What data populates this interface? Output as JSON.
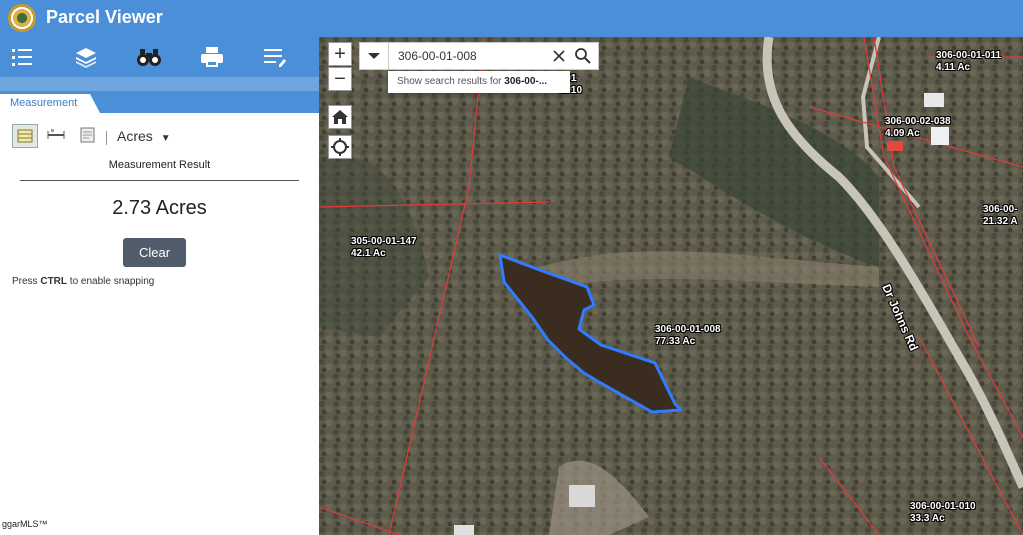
{
  "header": {
    "title": "Parcel Viewer"
  },
  "toolbar": {
    "tools": [
      "list-icon",
      "layers-icon",
      "binoculars-icon",
      "print-icon",
      "edit-list-icon"
    ]
  },
  "panel": {
    "tab_label": "Measurement",
    "unit": "Acres",
    "result_label": "Measurement Result",
    "result_value": "2.73 Acres",
    "clear_label": "Clear",
    "hint_prefix": "Press ",
    "hint_key": "CTRL",
    "hint_suffix": " to enable snapping"
  },
  "watermark": "ggarMLS™",
  "map": {
    "zoom_in": "+",
    "zoom_out": "−",
    "search_value": "306-00-01-008",
    "suggest_prefix": "Show search results for ",
    "suggest_bold": "306-00-...",
    "road_label": "Dr Johns Rd",
    "parcels": [
      {
        "id": "306-00-01-011",
        "area": "4.11 Ac"
      },
      {
        "id": "306-00-02-038",
        "area": "4.09 Ac"
      },
      {
        "id": "306-00-",
        "area": "21.32 A"
      },
      {
        "id": "305-00-01-147",
        "area": "42.1 Ac"
      },
      {
        "id": "306-00-01-008",
        "area": "77.33 Ac"
      },
      {
        "id": "306-00-01-010",
        "area": "33.3 Ac"
      },
      {
        "id": "...01",
        "area": "49.10"
      }
    ]
  },
  "colors": {
    "header": "#4a8fd8",
    "measure_outline": "#3b6ff0",
    "parcel_line": "#e23a3a"
  }
}
